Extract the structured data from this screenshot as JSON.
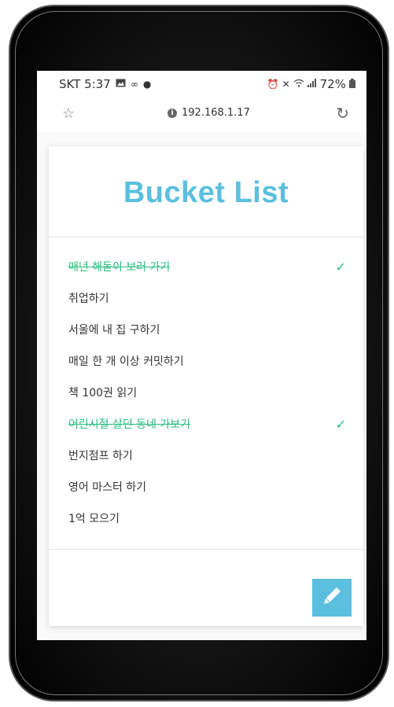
{
  "status_bar": {
    "time": "SKT 5:37",
    "battery": "72%"
  },
  "browser": {
    "url": "192.168.1.17"
  },
  "page": {
    "title": "Bucket List",
    "items": [
      {
        "text": "매년 해돋이 보러 가기",
        "done": true
      },
      {
        "text": "취업하기",
        "done": false
      },
      {
        "text": "서울에 내 집 구하기",
        "done": false
      },
      {
        "text": "매일 한 개 이상 커밋하기",
        "done": false
      },
      {
        "text": "책 100권 읽기",
        "done": false
      },
      {
        "text": "어린시절 살던 동네 가보기",
        "done": true
      },
      {
        "text": "번지점프 하기",
        "done": false
      },
      {
        "text": "영어 마스터 하기",
        "done": false
      },
      {
        "text": "1억 모으기",
        "done": false
      }
    ]
  },
  "colors": {
    "accent": "#5bbfdf",
    "done": "#2bbd7e"
  }
}
